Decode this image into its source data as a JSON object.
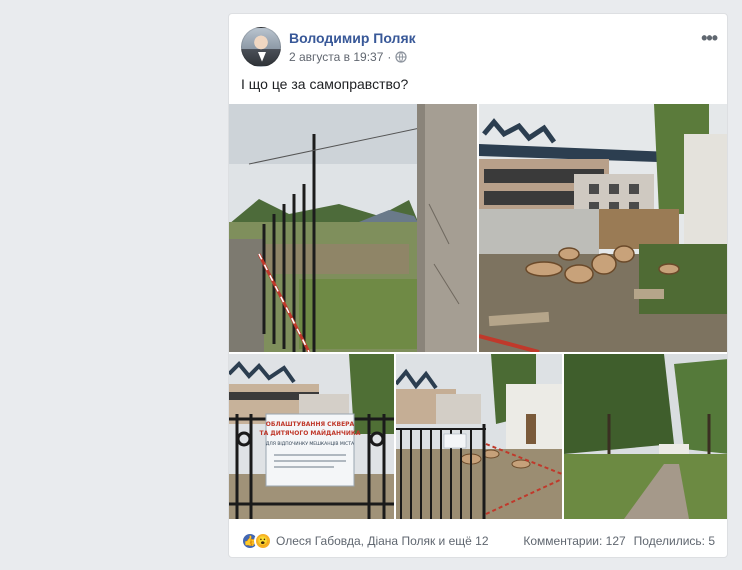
{
  "post": {
    "author": "Володимир Поляк",
    "date": "2 августа в 19:37",
    "privacy_icon": "globe-icon",
    "more_icon": "more-options-icon",
    "text": "І що це за самоправство?"
  },
  "photos": [
    {
      "name": "fence-and-field-photo"
    },
    {
      "name": "cut-tree-stumps-photo"
    },
    {
      "name": "construction-sign-photo"
    },
    {
      "name": "fenced-area-photo"
    },
    {
      "name": "park-path-photo"
    }
  ],
  "sign": {
    "title": "ОБЛАШТУВАННЯ СКВЕРА ТА ДИТЯЧОГО МАЙДАНЧИКА",
    "subtitle": "ДЛЯ ВІДПОЧИНКУ МЕШКАНЦІВ МІСТА"
  },
  "footer": {
    "reaction_icons": [
      "like-icon",
      "wow-icon"
    ],
    "reactors": "Олеся Габовда, Діана Поляк и ещё 12",
    "comments": "Комментарии: 127",
    "shares": "Поделились: 5"
  },
  "colors": {
    "link": "#385898",
    "like": "#4267b2",
    "wow": "#f7b125"
  }
}
